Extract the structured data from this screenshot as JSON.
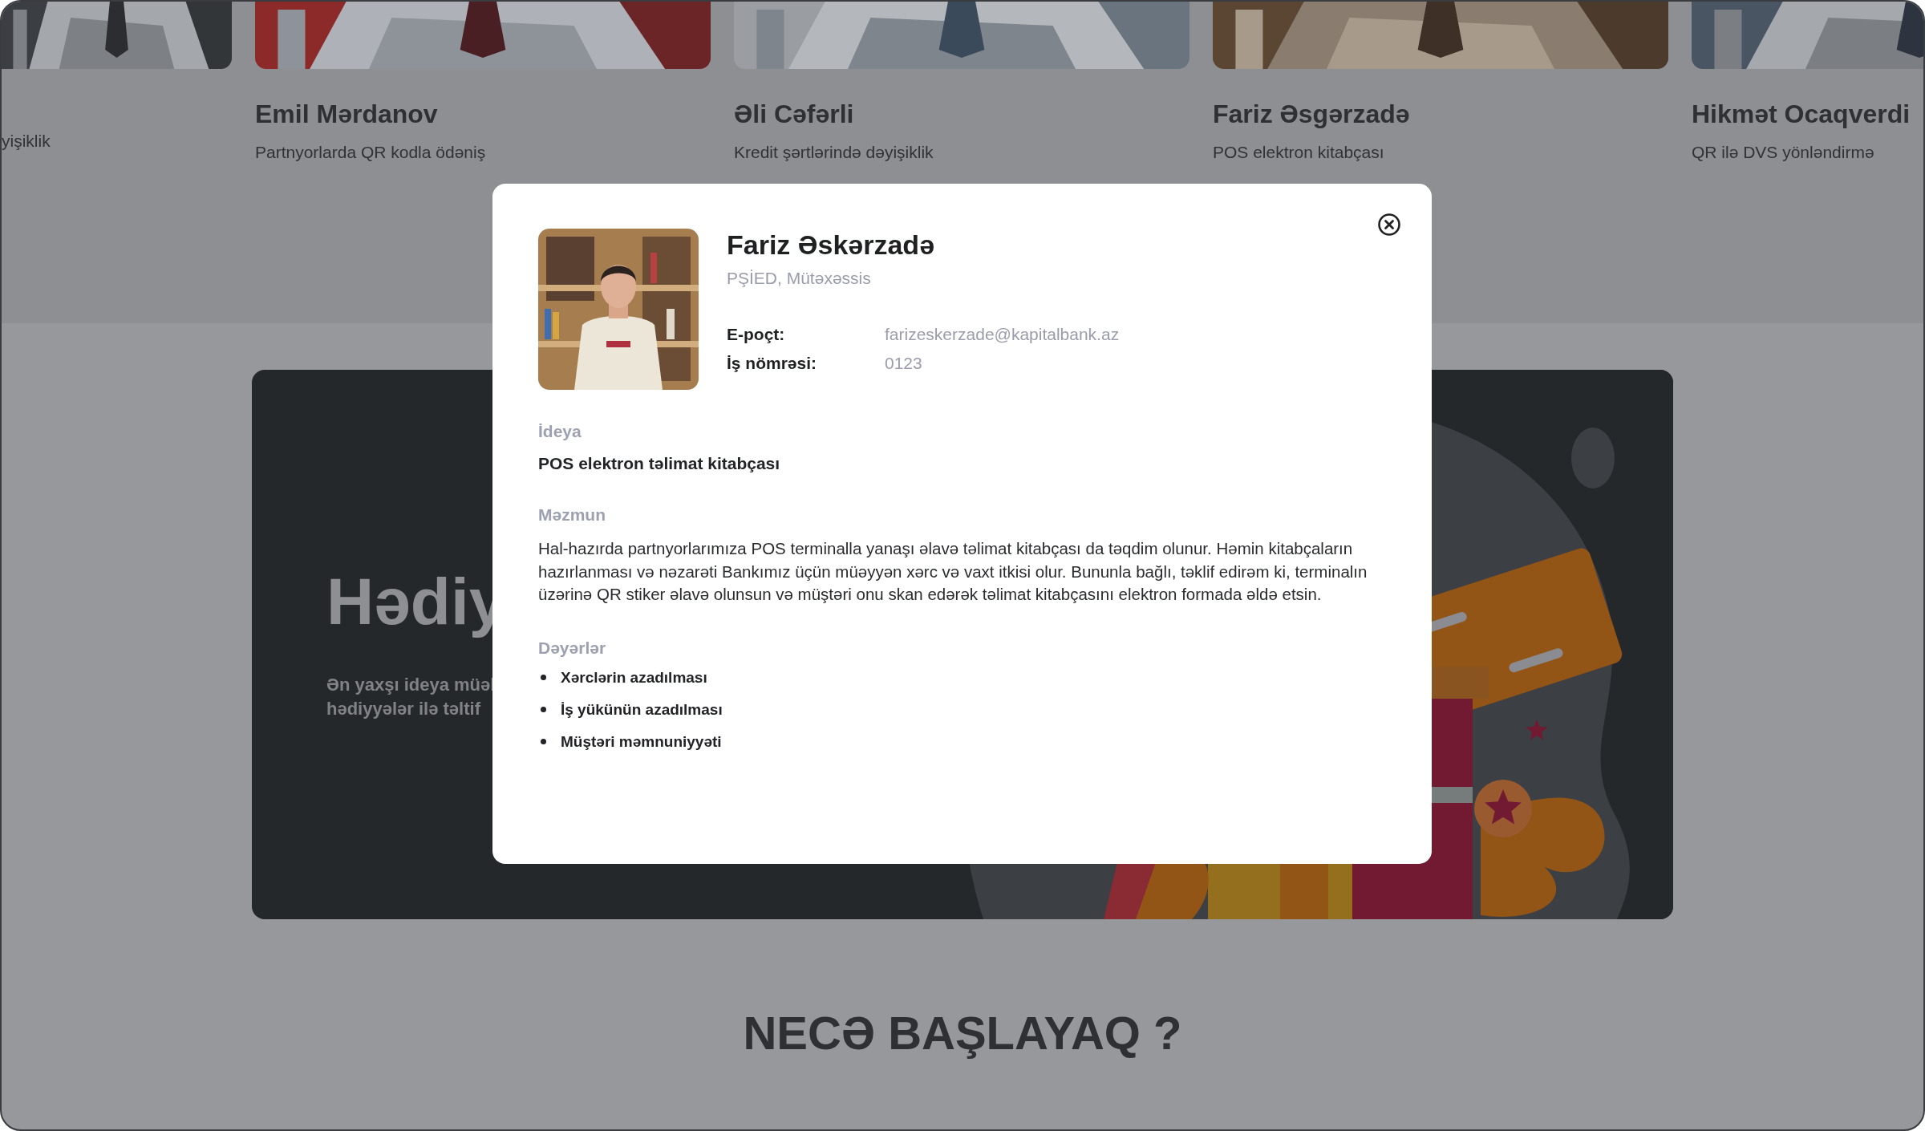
{
  "people_cards": [
    {
      "subtitle": "yişiklik"
    },
    {
      "name": "Emil Mərdanov",
      "subtitle": "Partnyorlarda QR kodla ödəniş"
    },
    {
      "name": "Əli Cəfərli",
      "subtitle": "Kredit şərtlərində dəyişiklik"
    },
    {
      "name": "Fariz Əsgərzadə",
      "subtitle": "POS elektron kitabçası"
    },
    {
      "name": "Hikmət Ocaqverdi",
      "subtitle": "QR ilə DVS yönləndirmə"
    }
  ],
  "banner": {
    "title": "Hədiy",
    "description_lines": [
      "Ən yaxşı ideya müəl",
      "hədiyyələr ilə təltif"
    ]
  },
  "section_heading": "NECƏ BAŞLAYAQ ?",
  "modal": {
    "name": "Fariz Əskərzadə",
    "role": "PŞİED, Mütəxəssis",
    "fields": [
      {
        "label": "E-poçt:",
        "value": "farizeskerzade@kapitalbank.az"
      },
      {
        "label": "İş nömrəsi:",
        "value": "0123"
      }
    ],
    "sections": [
      {
        "kind": "text",
        "heading": "İdeya",
        "text": "POS elektron təlimat kitabçası"
      },
      {
        "kind": "paragraph",
        "heading": "Məzmun",
        "text": "Hal-hazırda partnyorlarımıza POS terminalla yanaşı əlavə təlimat kitabçası da təqdim olunur. Həmin kitabçaların hazırlanması və nəzarəti Bankımız üçün müəyyən xərc və vaxt itkisi olur. Bununla bağlı, təklif edirəm ki, terminalın üzərinə QR stiker əlavə olunsun və müştəri onu skan edərək təlimat kitabçasını elektron formada əldə etsin."
      },
      {
        "kind": "list",
        "heading": "Dəyərlər",
        "items": [
          "Xərclərin azadılması",
          "İş yükünün azadılması",
          "Müştəri məmnuniyyəti"
        ]
      }
    ]
  }
}
